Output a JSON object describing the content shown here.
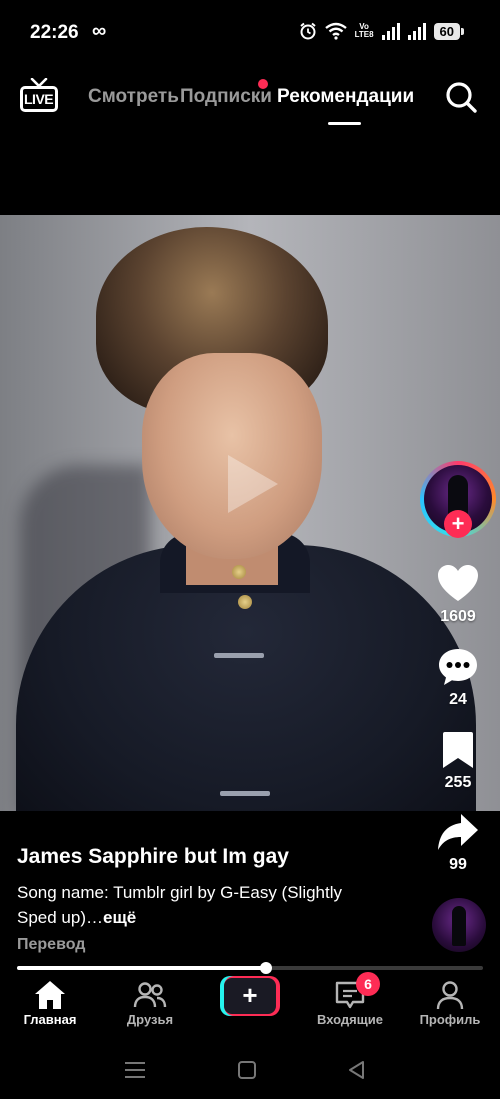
{
  "status_bar": {
    "time": "22:26",
    "infinity": "∞",
    "volte_top": "Vo",
    "volte_bottom": "LTE8",
    "battery": "60"
  },
  "top_nav": {
    "live_label": "LIVE",
    "tabs": [
      {
        "label": "Смотреть",
        "active": false
      },
      {
        "label": "Подписки",
        "active": false,
        "has_dot": true
      },
      {
        "label": "Рекомендации",
        "active": true
      }
    ],
    "search_icon": "search-icon"
  },
  "rail": {
    "likes": "1609",
    "comments": "24",
    "saves": "255",
    "shares": "99",
    "follow_glyph": "+"
  },
  "caption": {
    "title": "James Sapphire but Im gay",
    "description": "Song name: Tumblr girl by G-Easy (Slightly Sped up)…",
    "more": "ещё",
    "translate": "Перевод"
  },
  "progress": {
    "fraction": 0.535
  },
  "bottom_nav": {
    "items": [
      {
        "label": "Главная",
        "icon": "home-icon",
        "active": true
      },
      {
        "label": "Друзья",
        "icon": "friends-icon",
        "active": false
      },
      {
        "label": "",
        "icon": "create-icon",
        "active": false
      },
      {
        "label": "Входящие",
        "icon": "inbox-icon",
        "active": false
      },
      {
        "label": "Профиль",
        "icon": "profile-icon",
        "active": false
      }
    ],
    "inbox_badge": "6",
    "create_glyph": "+"
  },
  "colors": {
    "accent": "#fe2c55",
    "cyan": "#25f4ee",
    "background": "#000000"
  }
}
